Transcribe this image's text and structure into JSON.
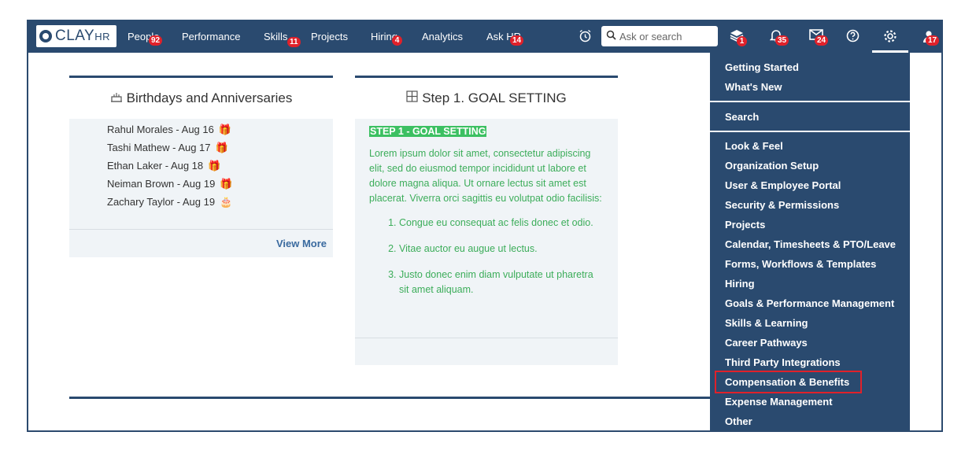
{
  "logo": {
    "word": "CLAY",
    "suffix": "HR"
  },
  "nav": [
    {
      "label": "People",
      "badge": "92"
    },
    {
      "label": "Performance",
      "badge": ""
    },
    {
      "label": "Skills",
      "badge": "11"
    },
    {
      "label": "Projects",
      "badge": ""
    },
    {
      "label": "Hiring",
      "badge": "4"
    },
    {
      "label": "Analytics",
      "badge": ""
    },
    {
      "label": "Ask HR",
      "badge": "14"
    }
  ],
  "search": {
    "placeholder": "Ask or search"
  },
  "icons": {
    "alarm": "alarm-clock-icon",
    "tasks": {
      "name": "stack-icon",
      "badge": "1"
    },
    "notifications": {
      "name": "bell-icon",
      "badge": "35"
    },
    "messages": {
      "name": "envelope-icon",
      "badge": "24"
    },
    "help": "help-icon",
    "settings": "gear-icon",
    "profile": {
      "name": "avatar-icon",
      "badge": "17"
    }
  },
  "birthdays": {
    "title": "Birthdays and Anniversaries",
    "items": [
      "Rahul Morales - Aug 16",
      "Tashi Mathew - Aug 17",
      "Ethan Laker - Aug 18",
      "Neiman Brown - Aug 19",
      "Zachary Taylor - Aug 19"
    ],
    "view_more": "View More"
  },
  "goal": {
    "title": "Step 1. GOAL SETTING",
    "heading": "STEP 1 - GOAL SETTING",
    "paragraph": "Lorem ipsum dolor sit amet, consectetur adipiscing elit, sed do eiusmod tempor incididunt ut labore et dolore magna aliqua. Ut ornare lectus sit amet est placerat. Viverra orci sagittis eu volutpat odio facilisis:",
    "list": [
      "Congue eu consequat ac felis donec et odio.",
      "Vitae auctor eu augue ut lectus.",
      "Justo donec enim diam vulputate ut pharetra sit amet aliquam."
    ]
  },
  "settings_menu": {
    "group1": [
      "Getting Started",
      "What's New"
    ],
    "group2": [
      "Search"
    ],
    "group3": [
      "Look & Feel",
      "Organization Setup",
      "User & Employee Portal",
      "Security & Permissions",
      "Projects",
      "Calendar, Timesheets & PTO/Leave",
      "Forms, Workflows & Templates",
      "Hiring",
      "Goals & Performance Management",
      "Skills & Learning",
      "Career Pathways",
      "Third Party Integrations",
      "Compensation & Benefits",
      "Expense Management",
      "Other"
    ],
    "highlighted": "Compensation & Benefits"
  },
  "colors": {
    "navbar": "#2a4a6f",
    "badge": "#e0212a",
    "goal_text": "#3cad5a",
    "highlight": "#3cc062"
  }
}
